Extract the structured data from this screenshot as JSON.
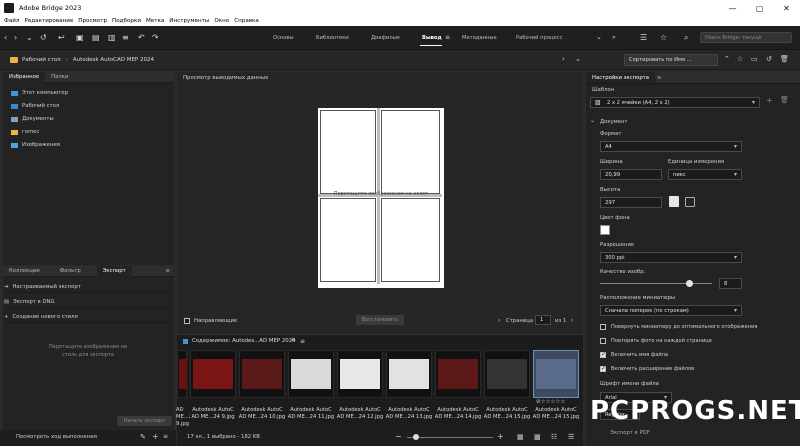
{
  "window": {
    "title": "Adobe Bridge 2023"
  },
  "menu": [
    "Файл",
    "Редактирование",
    "Просмотр",
    "Подборки",
    "Метка",
    "Инструменты",
    "Окно",
    "Справка"
  ],
  "workspaces": [
    "Основы",
    "Библиотеки",
    "Диафильм",
    "Вывод",
    "Метаданные",
    "Рабочий процесс"
  ],
  "active_workspace": "Вывод",
  "search_placeholder": "Поиск Bridge: текуще",
  "breadcrumb": [
    "Рабочий стол",
    "Autodesk AutoCAD MEP 2024"
  ],
  "sort_label": "Сортировать по Имя ...",
  "left_tabs": {
    "favorites": "Избранное",
    "folders": "Папки"
  },
  "favorites": [
    {
      "label": "Этот компьютер",
      "icon": "computer-icon"
    },
    {
      "label": "Рабочий стол",
      "icon": "desktop-icon"
    },
    {
      "label": "Документы",
      "icon": "documents-icon"
    },
    {
      "label": "гоmec",
      "icon": "folder-icon"
    },
    {
      "label": "Изображения",
      "icon": "images-icon"
    }
  ],
  "lower_tabs": {
    "collections": "Коллекции",
    "filter": "Фильтр",
    "export": "Экспорт"
  },
  "export_items": [
    "Настраиваемый экспорт",
    "Экспорт в DNG",
    "Создание нового стиля"
  ],
  "export_hint": "Перетащите изображения на стиль для экспорта",
  "start_export": "Начать экспорт",
  "view_progress": "Посмотреть ход выполнения",
  "preview": {
    "title": "Просмотр выводимых данных",
    "drop_hint": "Перетащите изображения на холст",
    "guides": "Направляющие",
    "restore": "Восстановить",
    "page_label": "Страница",
    "page_value": "1",
    "page_of": "из 1"
  },
  "content": {
    "title": "Содержимое: Autodes...AD MEP 2024",
    "thumbs": [
      {
        "label": "AD ME...24 9.jpg",
        "color": "#6a1212"
      },
      {
        "label": "Autodesk AutoC AD ME...24 9.jpg",
        "color": "#7a1515"
      },
      {
        "label": "Autodesk AutoC AD ME...24 10.jpg",
        "color": "#5a1a1a"
      },
      {
        "label": "Autodesk AutoC AD ME...24 11.jpg",
        "color": "#d9d9d9"
      },
      {
        "label": "Autodesk AutoC AD ME...24 12.jpg",
        "color": "#e8e8e8"
      },
      {
        "label": "Autodesk AutoC AD ME...24 13.jpg",
        "color": "#e2e2e2"
      },
      {
        "label": "Autodesk AutoC AD ME...24 14.jpg",
        "color": "#5c1717"
      },
      {
        "label": "Autodesk AutoC AD ME...24 15.jpg",
        "color": "#333"
      },
      {
        "label": "Autodesk AutoC AD ME...24 15.jpg",
        "color": "#5a6b8a"
      }
    ],
    "status": "17 эл., 1 выбрано - 182 KB"
  },
  "settings": {
    "title": "Настройки экспорта",
    "template_label": "Шаблон",
    "template_value": "2 x 2 ячейки (A4, 2 x 2)",
    "document": "Документ",
    "format_label": "Формат",
    "format_value": "A4",
    "width_label": "Ширина",
    "width_value": "20,99",
    "unit_label": "Единица измерения",
    "unit_value": "пикс",
    "height_label": "Высота",
    "height_value": "297",
    "bg_label": "Цвет фона",
    "resolution_label": "Разрешение",
    "resolution_value": "300 ppi",
    "quality_label": "Качество изобр.",
    "quality_value": "8",
    "quality_level": 0.8,
    "layout_label": "Расположение миниатюры",
    "layout_value": "Сначала поперек (по строкам)",
    "opt_rotate": "Повернуть миниатюру до оптимального отображения",
    "opt_repeat": "Повторять фото на каждой странице",
    "opt_filename": "Включить имя файла",
    "opt_ext": "Включить расширение файлов",
    "font_label": "Шрифт имени файла",
    "font_value": "Arial",
    "style_value": "Regular",
    "export_pdf": "Экспорт в PDF"
  },
  "watermark": "PCPROGS.NET"
}
